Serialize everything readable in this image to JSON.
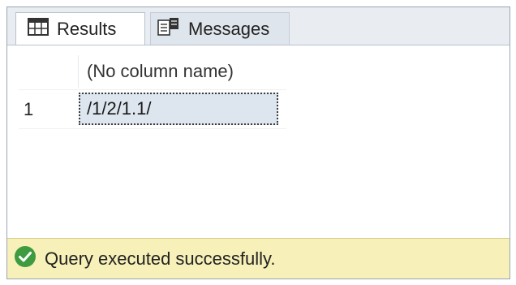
{
  "tabs": {
    "results_label": "Results",
    "messages_label": "Messages"
  },
  "grid": {
    "column_header": "(No column name)",
    "rows": [
      {
        "row_number": "1",
        "value": "/1/2/1.1/"
      }
    ]
  },
  "status": {
    "message": "Query executed successfully.",
    "color": "#f7f0b8",
    "success_icon_color": "#3f9b3f"
  },
  "icons": {
    "results": "grid-icon",
    "messages": "messages-icon",
    "status": "check-circle-icon"
  }
}
